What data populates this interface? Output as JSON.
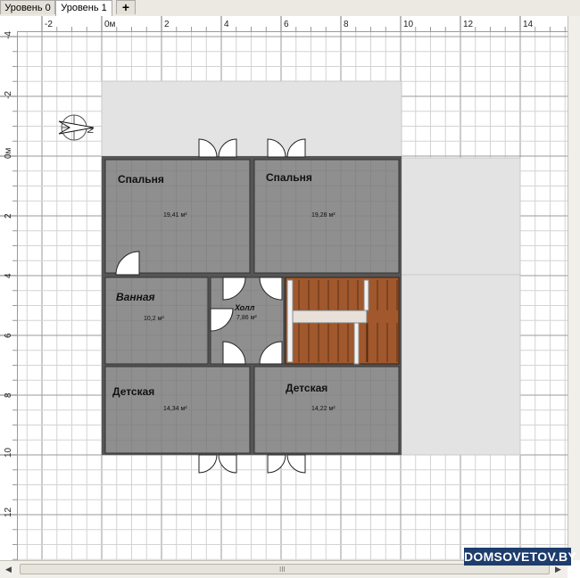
{
  "tabs": [
    {
      "label": "Уровень 0",
      "active": false
    },
    {
      "label": "Уровень 1",
      "active": true
    }
  ],
  "add_tab_label": "+",
  "ruler": {
    "top_ticks": [
      "-2",
      "0м",
      "2",
      "4",
      "6",
      "8",
      "10",
      "12",
      "14"
    ],
    "left_ticks": [
      "-4",
      "-2",
      "0м",
      "2",
      "4",
      "6",
      "8",
      "10",
      "12"
    ]
  },
  "compass": {
    "label": "N"
  },
  "rooms": [
    {
      "name": "Спальня",
      "area": "19,41 м²"
    },
    {
      "name": "Спальня",
      "area": "19,28 м²"
    },
    {
      "name": "Ванная",
      "area": "10,2 м²"
    },
    {
      "name": "Холл",
      "area": "7,86 м²"
    },
    {
      "name": "Детская",
      "area": "14,34 м²"
    },
    {
      "name": "Детская",
      "area": "14,22 м²"
    }
  ],
  "colors": {
    "room_fill": "#8f8f8f",
    "ghost_fill": "#e3e3e3",
    "stair_fill": "#a0582c",
    "watermark_bg": "#1e3c6c"
  },
  "watermark": "DOMSOVETOV.BY",
  "scroll_grip": "III"
}
